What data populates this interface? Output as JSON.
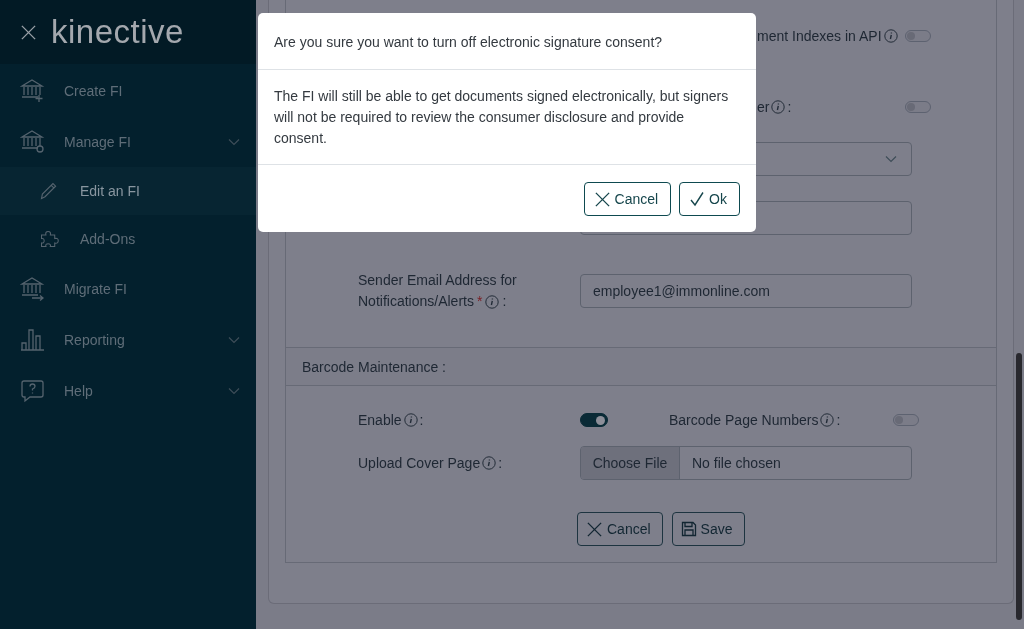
{
  "sidebar": {
    "logo": "kinective",
    "items": [
      {
        "label": "Create FI",
        "kind": "link",
        "selected": false
      },
      {
        "label": "Manage FI",
        "kind": "group",
        "selected": false,
        "children": [
          {
            "label": "Edit an FI",
            "selected": true
          },
          {
            "label": "Add-Ons",
            "selected": false
          }
        ]
      },
      {
        "label": "Migrate FI",
        "kind": "link",
        "selected": false
      },
      {
        "label": "Reporting",
        "kind": "group",
        "selected": false
      },
      {
        "label": "Help",
        "kind": "group",
        "selected": false
      }
    ]
  },
  "form": {
    "partial_rows": [
      {
        "label": "ment Indexes in API",
        "on": false
      },
      {
        "label": "er",
        "suffix": ":",
        "on": false
      }
    ],
    "sender_email": {
      "label_lines": [
        "Sender Email Address for",
        "Notifications/Alerts"
      ],
      "required_mark": "*",
      "suffix": ":",
      "value": "employee1@immonline.com"
    },
    "barcode": {
      "title": "Barcode Maintenance :",
      "enable": {
        "label": "Enable",
        "suffix": ":",
        "on": true
      },
      "page_numbers": {
        "label": "Barcode Page Numbers",
        "suffix": ":",
        "on": false
      },
      "upload": {
        "label": "Upload Cover Page",
        "suffix": ":",
        "button": "Choose File",
        "status": "No file chosen"
      }
    },
    "buttons": {
      "cancel": "Cancel",
      "save": "Save"
    }
  },
  "modal": {
    "title": "Are you sure you want to turn off electronic signature consent?",
    "message": "The FI will still be able to get documents signed electronically, but signers will not be required to review the consumer disclosure and provide consent.",
    "buttons": {
      "cancel": "Cancel",
      "ok": "Ok"
    }
  }
}
